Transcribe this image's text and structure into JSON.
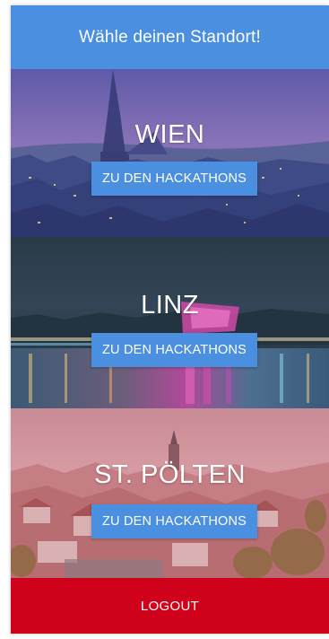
{
  "header": {
    "title": "Wähle deinen Standort!"
  },
  "cities": [
    {
      "name": "WIEN",
      "button_label": "ZU DEN HACKATHONS"
    },
    {
      "name": "LINZ",
      "button_label": "ZU DEN HACKATHONS"
    },
    {
      "name": "ST. PÖLTEN",
      "button_label": "ZU DEN HACKATHONS"
    }
  ],
  "footer": {
    "logout_label": "LOGOUT"
  },
  "colors": {
    "header_blue": "#4a8fe0",
    "button_blue": "#4a8fe0",
    "logout_red": "#d0021b"
  }
}
